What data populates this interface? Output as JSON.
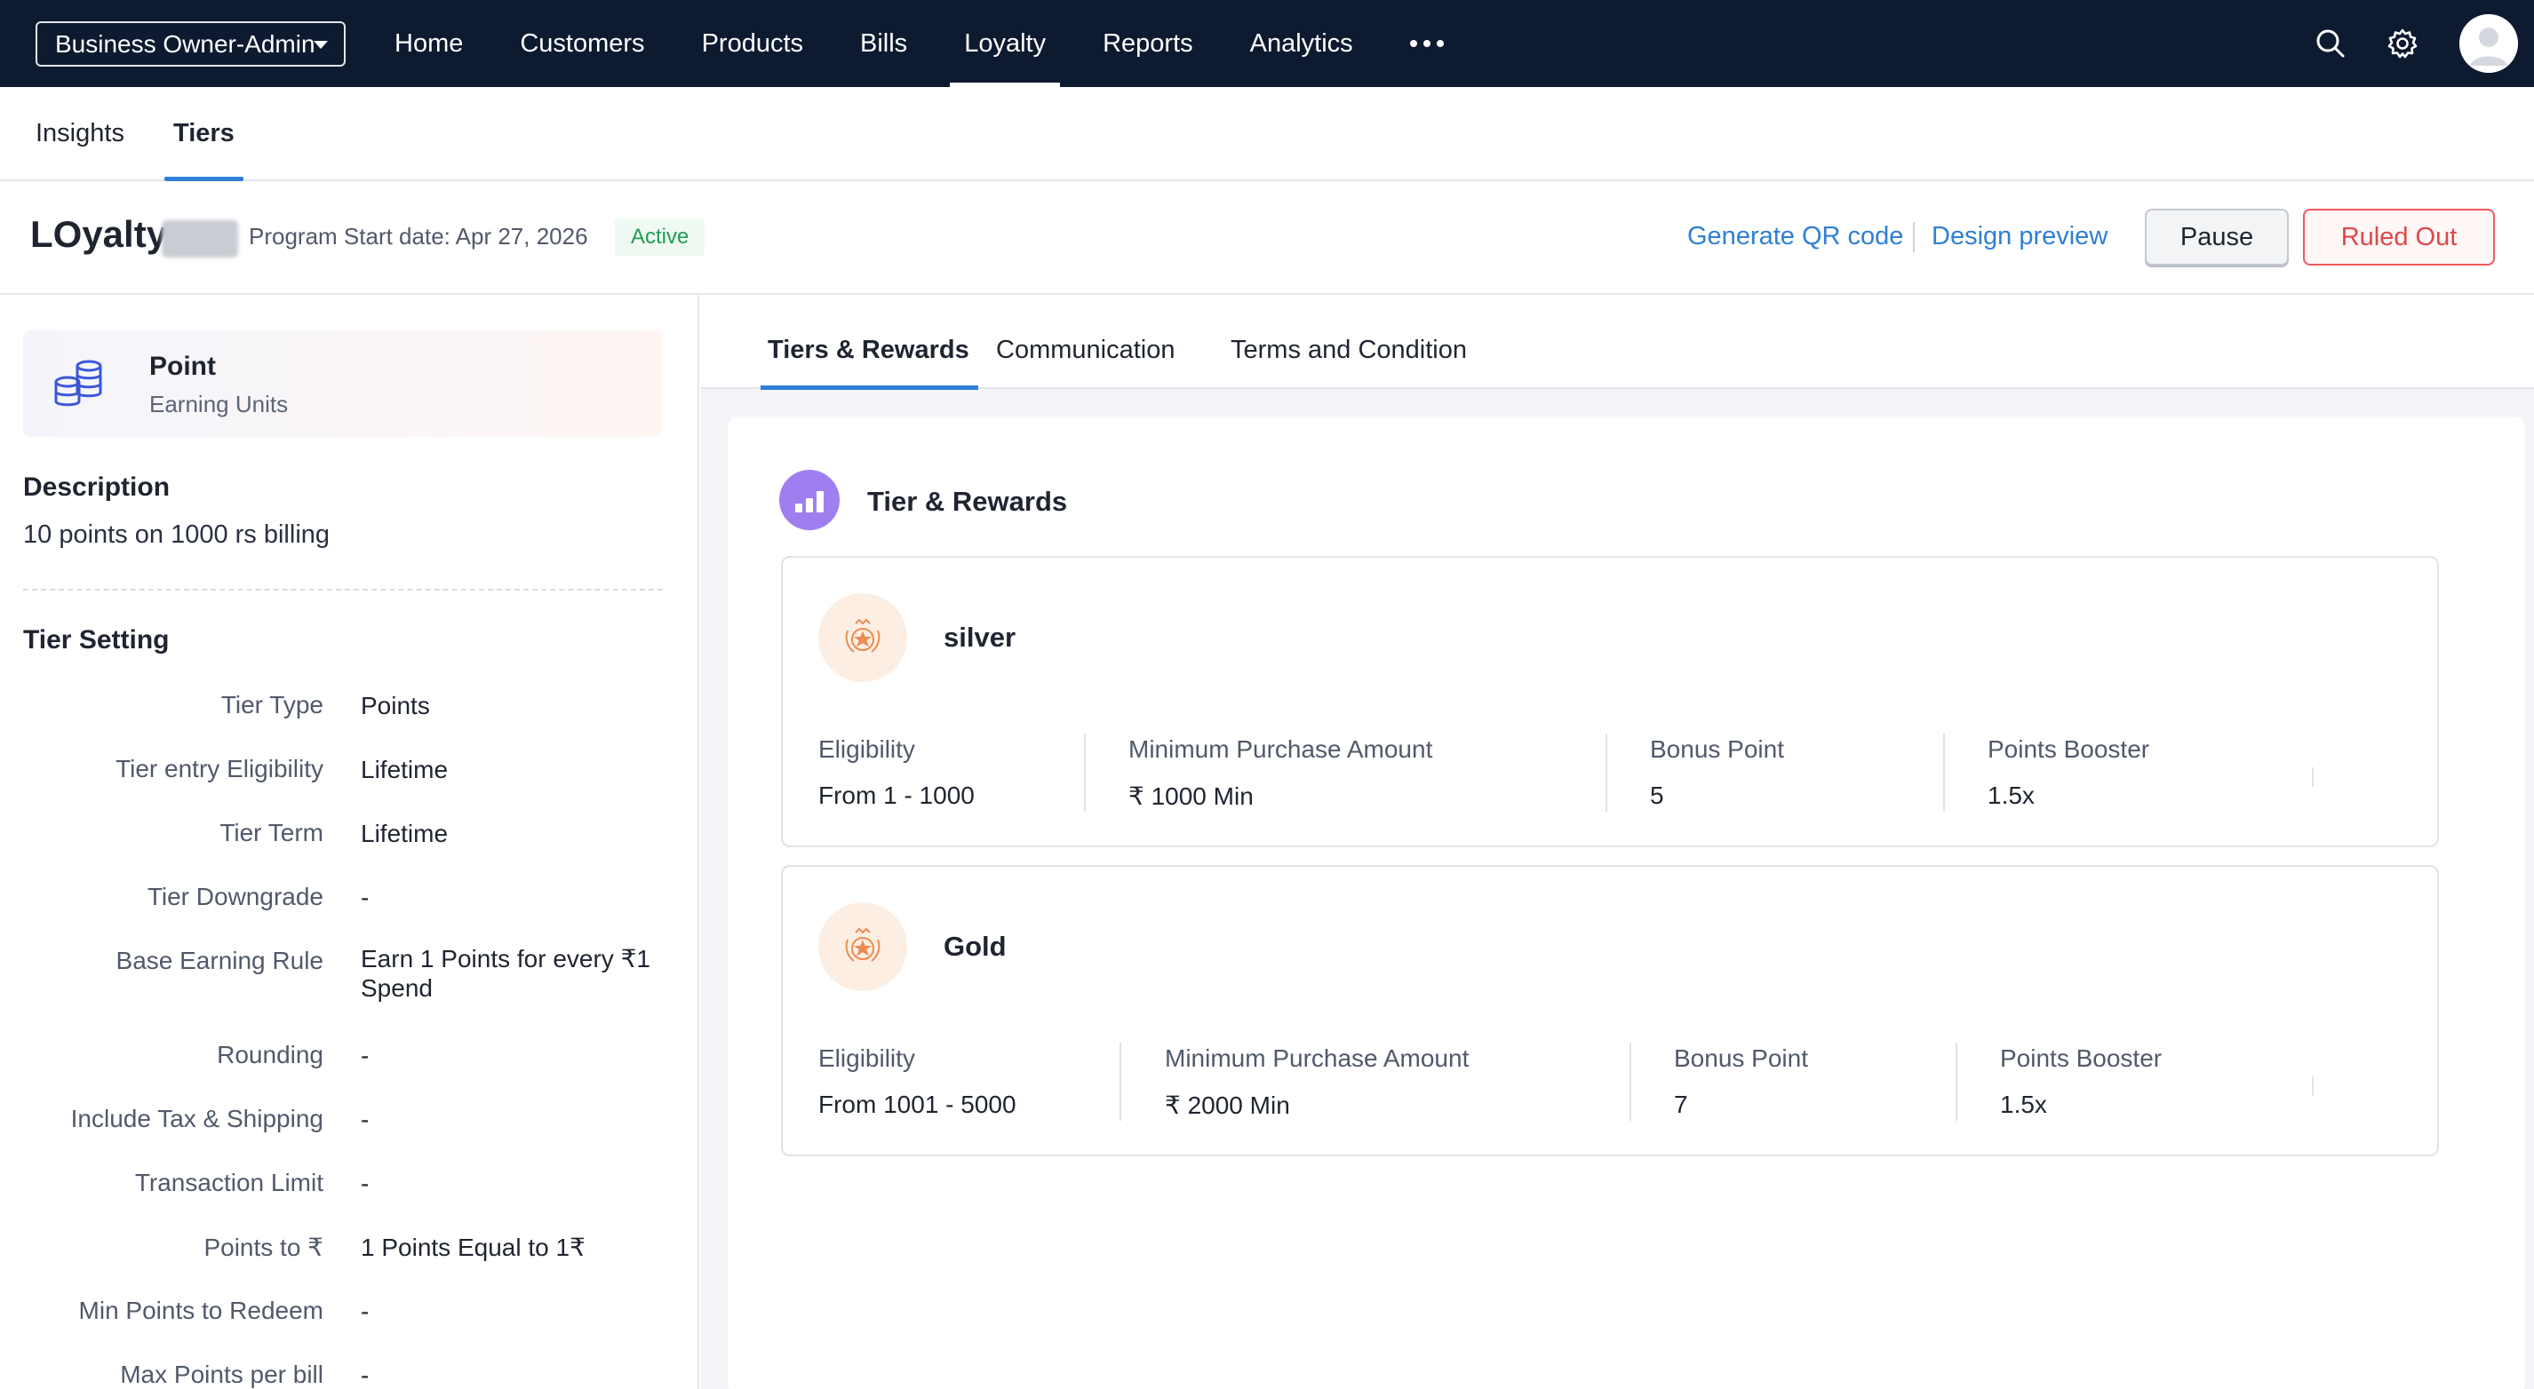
{
  "topbar": {
    "org_selector": "Business Owner-Admin",
    "nav": [
      "Home",
      "Customers",
      "Products",
      "Bills",
      "Loyalty",
      "Reports",
      "Analytics"
    ],
    "active_nav": "Loyalty",
    "icons": [
      "search-icon",
      "gear-icon",
      "avatar"
    ]
  },
  "subtabs": {
    "insights": "Insights",
    "tiers": "Tiers",
    "active": "Tiers"
  },
  "program": {
    "title": "LOyalty",
    "start_date": "Program Start date: Apr 27, 2026",
    "status": "Active",
    "generate_qr": "Generate QR code",
    "design_preview": "Design preview",
    "pause": "Pause",
    "ruled_out": "Ruled Out"
  },
  "left": {
    "unit_title": "Point",
    "unit_sub": "Earning Units",
    "description_heading": "Description",
    "description_text": "10 points on 1000 rs billing",
    "tier_setting_heading": "Tier Setting",
    "settings": [
      {
        "label": "Tier Type",
        "value": "Points"
      },
      {
        "label": "Tier entry Eligibility",
        "value": "Lifetime"
      },
      {
        "label": "Tier Term",
        "value": "Lifetime"
      },
      {
        "label": "Tier Downgrade",
        "value": "-"
      },
      {
        "label": "Base Earning Rule",
        "value": "Earn 1 Points for every ₹1 Spend"
      },
      {
        "label": "Rounding",
        "value": "-"
      },
      {
        "label": "Include Tax & Shipping",
        "value": "-"
      },
      {
        "label": "Transaction Limit",
        "value": "-"
      },
      {
        "label": "Points to ₹",
        "value": "1 Points Equal to 1₹"
      },
      {
        "label": "Min Points to Redeem",
        "value": "-"
      },
      {
        "label": "Max Points per bill",
        "value": "-"
      }
    ]
  },
  "right": {
    "tabs": [
      "Tiers & Rewards",
      "Communication",
      "Terms and Condition"
    ],
    "active_tab": "Tiers & Rewards",
    "section_title": "Tier & Rewards",
    "col_labels": {
      "eligibility": "Eligibility",
      "min_purchase": "Minimum Purchase Amount",
      "bonus": "Bonus Point",
      "booster": "Points Booster"
    },
    "tiers": [
      {
        "name": "silver",
        "eligibility": "From 1 - 1000",
        "min_purchase": "₹ 1000 Min",
        "bonus": "5",
        "booster": "1.5x"
      },
      {
        "name": "Gold",
        "eligibility": "From 1001 - 5000",
        "min_purchase": "₹ 2000 Min",
        "bonus": "7",
        "booster": "1.5x"
      }
    ]
  }
}
